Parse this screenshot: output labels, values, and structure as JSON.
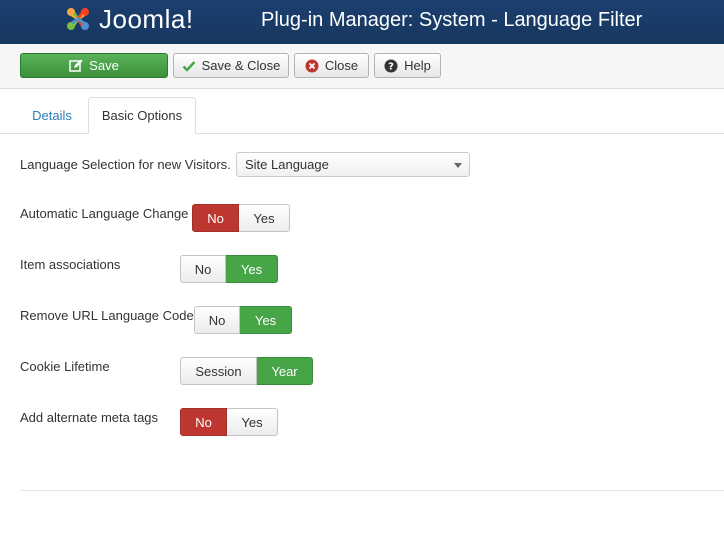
{
  "header": {
    "logo_text": "Joomla!",
    "title": "Plug-in Manager: System - Language Filter"
  },
  "toolbar": {
    "save_label": "Save",
    "save_close_label": "Save & Close",
    "close_label": "Close",
    "help_label": "Help"
  },
  "tabs": [
    {
      "label": "Details"
    },
    {
      "label": "Basic Options"
    }
  ],
  "form": {
    "lang_selection": {
      "label": "Language Selection for new Visitors.",
      "value": "Site Language"
    },
    "auto_change": {
      "label": "Automatic Language Change",
      "options": [
        "No",
        "Yes"
      ],
      "selected": "No"
    },
    "item_assoc": {
      "label": "Item associations",
      "options": [
        "No",
        "Yes"
      ],
      "selected": "Yes"
    },
    "remove_url": {
      "label": "Remove URL Language Code",
      "options": [
        "No",
        "Yes"
      ],
      "selected": "Yes"
    },
    "cookie": {
      "label": "Cookie Lifetime",
      "options": [
        "Session",
        "Year"
      ],
      "selected": "Year"
    },
    "alt_meta": {
      "label": "Add alternate meta tags",
      "options": [
        "No",
        "Yes"
      ],
      "selected": "No"
    }
  },
  "colors": {
    "header": "#1b3f6f",
    "save": "#46a546",
    "no_active": "#bd362f",
    "yes_active": "#46a546",
    "link": "#2a7fb8"
  },
  "icons": [
    "joomla-logo",
    "edit-icon",
    "check-icon",
    "close-circle-icon",
    "help-icon",
    "caret-down-icon"
  ]
}
